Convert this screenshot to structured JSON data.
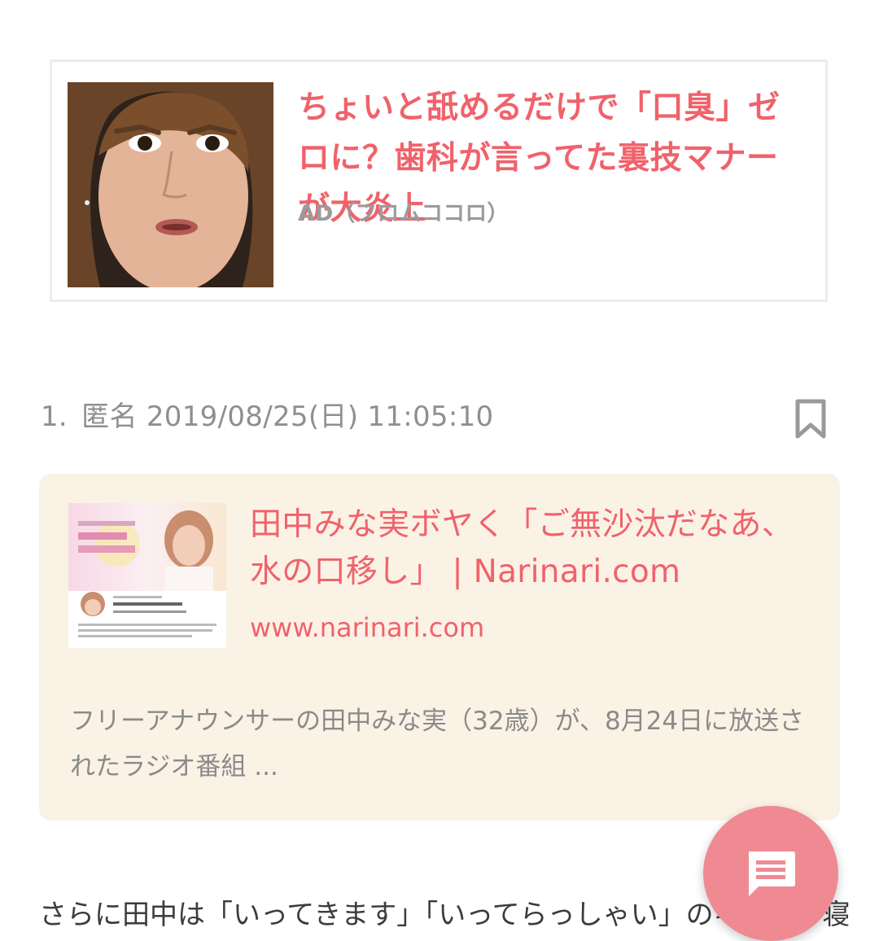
{
  "ad": {
    "headline": "ちょいと舐めるだけで「口臭」ゼロに？歯科が言ってた裏技マナーが大炎上",
    "source": "AD（フロムココロ）"
  },
  "comment": {
    "number": "1.",
    "author": "匿名",
    "datetime": "2019/08/25(日) 11:05:10"
  },
  "link_preview": {
    "title": "田中みな実ボヤく「ご無沙汰だなあ、水の口移し」 | Narinari.com",
    "url": "www.narinari.com",
    "description": "フリーアナウンサーの田中みな実（32歳）が、8月24日に放送されたラジオ番組 ..."
  },
  "body": {
    "text": "さらに田中は「いってきます」「いってらっしゃい」のキスや、寝る前にお"
  },
  "fab": {
    "icon": "comment-icon"
  },
  "colors": {
    "accent": "#f0626b",
    "card_background": "#fbf2e6",
    "fab": "#f08a92"
  }
}
